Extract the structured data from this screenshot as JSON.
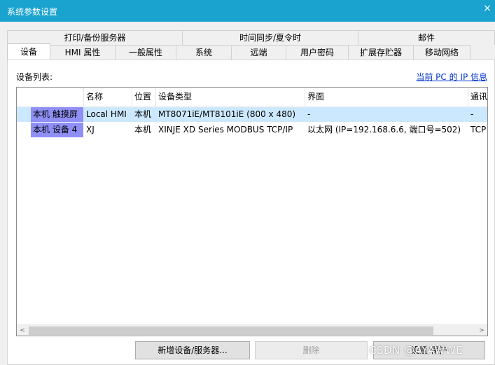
{
  "window": {
    "title": "系统参数设置",
    "close_glyph": "×"
  },
  "tabs_upper": [
    "打印/备份服务器",
    "时间同步/夏令时",
    "邮件"
  ],
  "tabs_lower": [
    "设备",
    "HMI 属性",
    "一般属性",
    "系统",
    "远端",
    "用户密码",
    "扩展存贮器",
    "移动网络"
  ],
  "active_tab": "设备",
  "panel": {
    "list_label": "设备列表:",
    "ip_link": "当前 PC 的 IP 信息"
  },
  "table": {
    "columns": [
      "名称",
      "位置",
      "设备类型",
      "界面",
      "通讯"
    ],
    "rows": [
      {
        "header": "本机 触摸屏",
        "cells": [
          "Local HMI",
          "本机",
          "MT8071iE/MT8101iE (800 x 480)",
          "-",
          "-"
        ]
      },
      {
        "header": "本机 设备 4",
        "cells": [
          "XJ",
          "本机",
          "XINJE XD Series MODBUS TCP/IP",
          "以太网 (IP=192.168.6.6, 端口号=502)",
          "TCP"
        ]
      }
    ]
  },
  "scrollbar": {
    "left_glyph": "<",
    "right_glyph": ">"
  },
  "buttons": {
    "add": "新增设备/服务器...",
    "delete": "删除",
    "settings": "设置/保护"
  },
  "watermark": "CSDN @AYAWWE",
  "colors": {
    "titlebar": "#1aa3cf",
    "selected_row": "#cce8ff",
    "row_header": "#8f8ff5",
    "link": "#0033cc"
  }
}
